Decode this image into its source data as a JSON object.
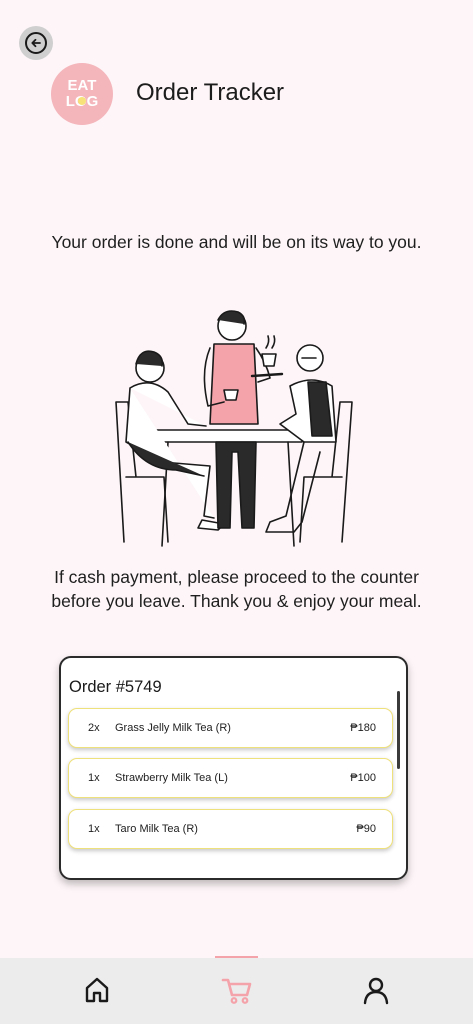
{
  "header": {
    "back_icon": "arrow-left-circle-icon",
    "logo_text_top": "EAT",
    "logo_text_bottom": "LOG",
    "title": "Order Tracker"
  },
  "main": {
    "status_message": "Your order is done and will be on its way to you.",
    "payment_message": "If cash payment, please proceed to the counter before you leave. Thank you & enjoy your meal."
  },
  "order": {
    "title": "Order #5749",
    "items": [
      {
        "qty": "2x",
        "name": "Grass Jelly Milk Tea (R)",
        "price": "₱180"
      },
      {
        "qty": "1x",
        "name": "Strawberry Milk Tea (L)",
        "price": "₱100"
      },
      {
        "qty": "1x",
        "name": "Taro Milk Tea (R)",
        "price": "₱90"
      }
    ]
  },
  "nav": {
    "items": [
      {
        "icon": "home-icon",
        "active": false
      },
      {
        "icon": "cart-icon",
        "active": true
      },
      {
        "icon": "profile-icon",
        "active": false
      }
    ]
  },
  "colors": {
    "background": "#fdf5f7",
    "accent_pink": "#f4a3aa",
    "item_border": "#eee07a",
    "nav_background": "#ececec"
  }
}
